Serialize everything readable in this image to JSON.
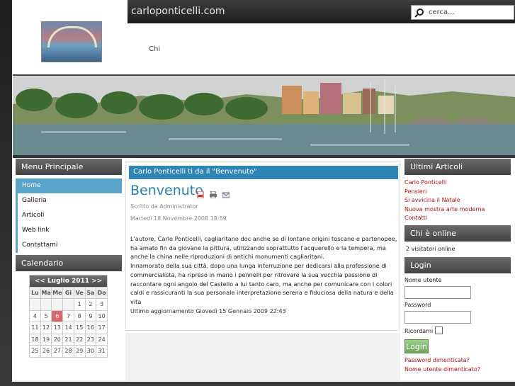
{
  "site": {
    "title": "carloponticelli.com"
  },
  "search": {
    "placeholder": "cerca..."
  },
  "nav": {
    "item": "Chi"
  },
  "main_menu": {
    "title": "Menu Principale",
    "items": [
      {
        "label": "Home",
        "active": true
      },
      {
        "label": "Galleria"
      },
      {
        "label": "Articoli"
      },
      {
        "label": "Web link"
      },
      {
        "label": "Contattami"
      }
    ]
  },
  "calendar": {
    "title": "Calendario",
    "prev": "<<",
    "month": "Luglio 2011",
    "next": ">>",
    "weekdays": [
      "Lu",
      "Ma",
      "Me",
      "Gi",
      "Ve",
      "Sa",
      "Do"
    ],
    "weeks": [
      [
        "",
        "",
        "",
        "",
        "1",
        "2",
        "3"
      ],
      [
        "4",
        "5",
        "6",
        "7",
        "8",
        "9",
        "10"
      ],
      [
        "11",
        "12",
        "13",
        "14",
        "15",
        "16",
        "17"
      ],
      [
        "18",
        "19",
        "20",
        "21",
        "22",
        "23",
        "24"
      ],
      [
        "25",
        "26",
        "27",
        "28",
        "29",
        "30",
        "31"
      ]
    ],
    "today": "6"
  },
  "article": {
    "bar_title": "Carlo Ponticelli ti da il \"Benvenuto\"",
    "title": "Benvenuto",
    "author": "Scritto da Administrator",
    "date": "Martedì 18 Novembre 2008 18:59",
    "body": "L'autore, Carlo Ponticelli, cagliaritano doc anche se di lontane origini toscane e partenopee, ha amato fin da giovane la pittura, utilizzando soprattutto l'acquerello e la tempera, ma anche la china nelle riproduzioni di antichi monumenti cagliaritani.\nInnamorato della sua città, dopo una lunga interruzione per dedicarsi alla professione di commercialista, ha ripreso in mano i pennelli per ritrovare la sua vecchia passione di raccontare ogni angolo del Castello a lui tanto caro, ma anche per comunicare con i colori caldi e rassicuranti la sua personale interpretazione serena e fiduciosa della natura e della vita",
    "updated": "Ultimo aggiornamento Giovedì 15 Gennaio 2009 22:43"
  },
  "latest": {
    "title": "Ultimi Articoli",
    "items": [
      "Carlo Ponticelli",
      "Pensieri",
      "Si avvicina il Natale",
      "Nuova mostra arte moderna",
      "Contatti"
    ]
  },
  "online": {
    "title": "Chi è online",
    "text": "2 visitatori online"
  },
  "login": {
    "title": "Login",
    "username_label": "Nome utente",
    "password_label": "Password",
    "remember_label": "Ricordami",
    "button": "Login",
    "forgot_password": "Password dimenticata?",
    "forgot_username": "Nome utente dimenticato?"
  },
  "colors": {
    "accent": "#2d86b5",
    "link": "#b01010",
    "menu_active": "#5aa3c9",
    "today": "#d96a6a"
  }
}
